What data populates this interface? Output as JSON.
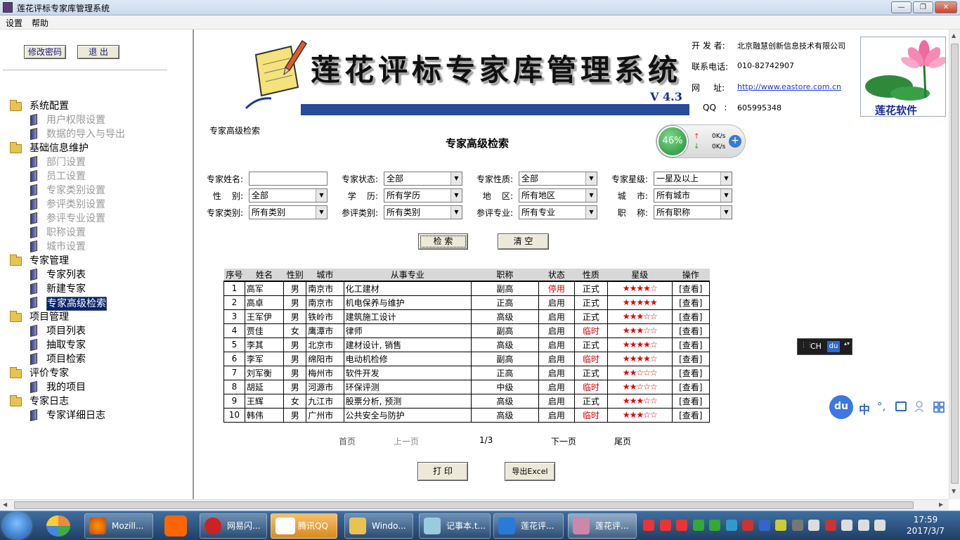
{
  "window": {
    "title": "莲花评标专家库管理系统",
    "minimize": "—",
    "restore": "❐",
    "close": "✕"
  },
  "menu": {
    "items": [
      "设置",
      "帮助"
    ]
  },
  "left": {
    "buttons": {
      "change_password": "修改密码",
      "logout": "退 出"
    },
    "tree": [
      {
        "label": "系统配置",
        "children": [
          "用户权限设置",
          "数据的导入与导出"
        ],
        "enabled": false
      },
      {
        "label": "基础信息维护",
        "children": [
          "部门设置",
          "员工设置",
          "专家类别设置",
          "参评类别设置",
          "参评专业设置",
          "职称设置",
          "城市设置"
        ],
        "enabled": false
      },
      {
        "label": "专家管理",
        "children": [
          "专家列表",
          "新建专家",
          "专家高级检索"
        ],
        "enabled": true
      },
      {
        "label": "项目管理",
        "children": [
          "项目列表",
          "抽取专家",
          "项目检索"
        ],
        "enabled": true
      },
      {
        "label": "评价专家",
        "children": [
          "我的项目"
        ],
        "enabled": true
      },
      {
        "label": "专家日志",
        "children": [
          "专家详细日志"
        ],
        "enabled": true
      }
    ],
    "selected": "专家高级检索"
  },
  "banner": {
    "title": "莲花评标专家库管理系统",
    "version": "V 4.3",
    "info": [
      {
        "label": "开 发 者:",
        "value": "北京融慧创新信息技术有限公司"
      },
      {
        "label": "联系电话:",
        "value": "010-82742907"
      },
      {
        "label": "网     址:",
        "value": "http://www.eastore.com.cn"
      },
      {
        "label": "QQ   :",
        "value": "605995348"
      }
    ],
    "brand": "莲花软件"
  },
  "network": {
    "percent": "46%",
    "up": "0K/s",
    "down": "0K/s"
  },
  "search": {
    "breadcrumb": "专家高级检索",
    "heading": "专家高级检索",
    "fields": [
      {
        "label": "专家姓名:",
        "value": "",
        "type": "input"
      },
      {
        "label": "专家状态:",
        "value": "全部"
      },
      {
        "label": "专家性质:",
        "value": "全部"
      },
      {
        "label": "专家星级:",
        "value": "一星及以上"
      },
      {
        "label": "性    别:",
        "value": "全部"
      },
      {
        "label": "学    历:",
        "value": "所有学历"
      },
      {
        "label": "地    区:",
        "value": "所有地区"
      },
      {
        "label": "城    市:",
        "value": "所有城市"
      },
      {
        "label": "专家类别:",
        "value": "所有类别"
      },
      {
        "label": "参评类别:",
        "value": "所有类别"
      },
      {
        "label": "参评专业:",
        "value": "所有专业"
      },
      {
        "label": "职    称:",
        "value": "所有职称"
      }
    ],
    "search_button": "检 索",
    "clear_button": "清 空"
  },
  "table": {
    "headers": [
      "序号",
      "姓名",
      "性别",
      "城市",
      "从事专业",
      "职称",
      "状态",
      "性质",
      "星级",
      "操作"
    ],
    "rows": [
      [
        "1",
        "高军",
        "男",
        "南京市",
        "化工建材",
        "副高",
        "停用",
        "正式",
        "★★★★☆",
        "[查看]"
      ],
      [
        "2",
        "高卓",
        "男",
        "南京市",
        "机电保养与维护",
        "正高",
        "启用",
        "正式",
        "★★★★★",
        "[查看]"
      ],
      [
        "3",
        "王军伊",
        "男",
        "铁岭市",
        "建筑施工设计",
        "高级",
        "启用",
        "正式",
        "★★★☆☆",
        "[查看]"
      ],
      [
        "4",
        "贾佳",
        "女",
        "鹰潭市",
        "律师",
        "副高",
        "启用",
        "临时",
        "★★★☆☆",
        "[查看]"
      ],
      [
        "5",
        "李其",
        "男",
        "北京市",
        "建材设计, 销售",
        "高级",
        "启用",
        "正式",
        "★★★★☆",
        "[查看]"
      ],
      [
        "6",
        "李军",
        "男",
        "绵阳市",
        "电动机检修",
        "副高",
        "启用",
        "临时",
        "★★★★☆",
        "[查看]"
      ],
      [
        "7",
        "刘军衡",
        "男",
        "梅州市",
        "软件开发",
        "正高",
        "启用",
        "正式",
        "★★☆☆☆",
        "[查看]"
      ],
      [
        "8",
        "胡延",
        "男",
        "河源市",
        "环保评测",
        "中级",
        "启用",
        "临时",
        "★★☆☆☆",
        "[查看]"
      ],
      [
        "9",
        "王辉",
        "女",
        "九江市",
        "股票分析, 预测",
        "高级",
        "启用",
        "正式",
        "★★★☆☆",
        "[查看]"
      ],
      [
        "10",
        "韩伟",
        "男",
        "广州市",
        "公共安全与防护",
        "高级",
        "启用",
        "临时",
        "★★★☆☆",
        "[查看]"
      ]
    ]
  },
  "pager": {
    "first": "首页",
    "prev": "上一页",
    "page": "1/3",
    "next": "下一页",
    "last": "尾页"
  },
  "actions": {
    "print": "打 印",
    "export": "导出Excel"
  },
  "ime": {
    "lang": "CH",
    "tag": "du"
  },
  "baidu": {
    "logo": "du",
    "mode": "中"
  },
  "taskbar": {
    "items": [
      "Mozill...",
      "网易闪...",
      "腾讯QQ",
      "Windo...",
      "记事本.t...",
      "莲花评...",
      "莲花评..."
    ],
    "time": "17:59",
    "date": "2017/3/7"
  }
}
